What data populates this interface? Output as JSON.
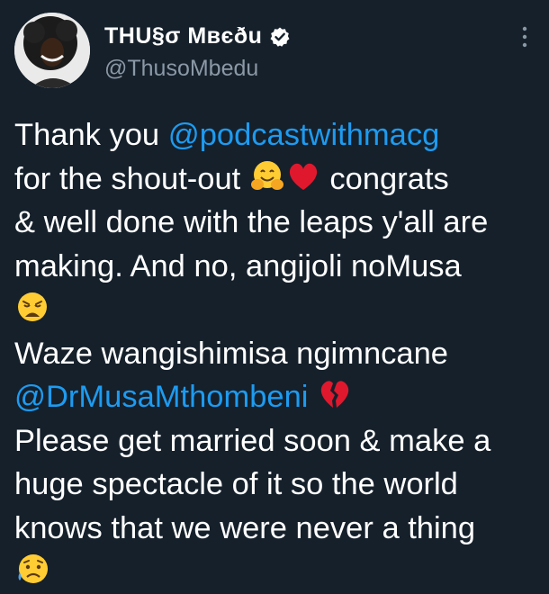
{
  "author": {
    "display_name": "THU§σ Mвєðu",
    "handle": "@ThusoMbedu",
    "verified": true
  },
  "icons": {
    "avatar": "profile-photo",
    "verified": "verified-badge-icon",
    "more": "more-options-icon"
  },
  "tweet": {
    "line1_text": "Thank you ",
    "line1_mention": "@podcastwithmacg",
    "line2_text_a": "for the shout-out ",
    "line2_text_b": " congrats",
    "line3_text": "& well done with the leaps y'all are",
    "line4_text": "making. And no, angijoli noMusa",
    "line6_text": "Waze wangishimisa ngimncane",
    "line7_mention": "@DrMusaMthombeni",
    "line8_text": "Please get married soon & make a",
    "line9_text": "huge spectacle of it so the world",
    "line10_text": "knows that we were never a thing"
  },
  "emojis": [
    "hugging-face",
    "red-heart",
    "weary-face",
    "broken-heart",
    "sad-sweat-face"
  ],
  "colors": {
    "background": "#15202b",
    "text": "#ffffff",
    "secondary_text": "#8b98a5",
    "mention": "#1d9bf0"
  }
}
